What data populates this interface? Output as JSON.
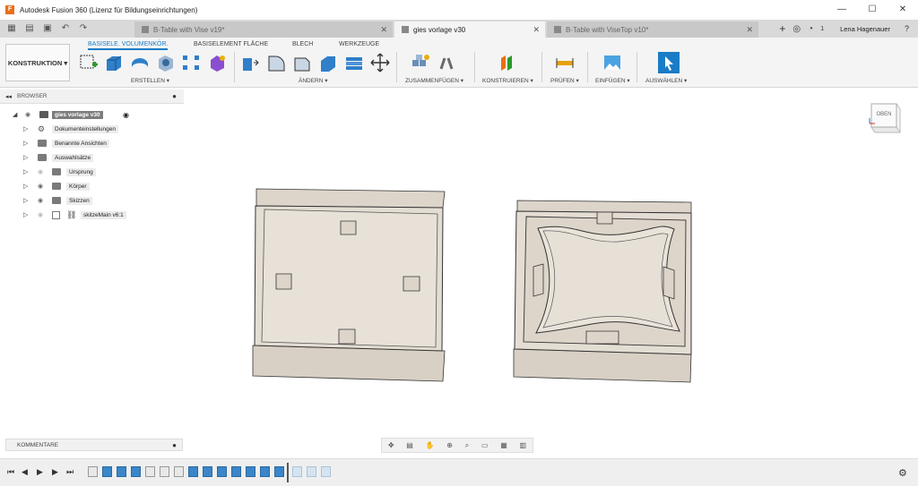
{
  "window": {
    "title": "Autodesk Fusion 360 (Lizenz für Bildungseinrichtungen)",
    "app_icon": "F",
    "minimize": "—",
    "maximize": "☐",
    "close": "✕"
  },
  "tabs": [
    {
      "label": "B-Table with Vise v19*",
      "active": false
    },
    {
      "label": "gies vorlage v30",
      "active": true
    },
    {
      "label": "B-Table with ViseTop v10*",
      "active": false
    }
  ],
  "tab_close": "✕",
  "header_right": {
    "job_count": "1",
    "user": "Lena Hagenauer"
  },
  "toolbar": {
    "workspace": "KONSTRUKTION ▾",
    "subtabs": [
      "BASISELE. VOLUMENKÖR.",
      "BASISELEMENT FLÄCHE",
      "BLECH",
      "WERKZEUGE"
    ],
    "groups": [
      "ERSTELLEN ▾",
      "ÄNDERN ▾",
      "ZUSAMMENFÜGEN ▾",
      "KONSTRUIEREN ▾",
      "PRÜFEN ▾",
      "EINFÜGEN ▾",
      "AUSWÄHLEN ▾"
    ]
  },
  "browser": {
    "title": "BROWSER",
    "root": "gies vorlage v30",
    "items": [
      {
        "label": "Dokumenteinstellungen",
        "icon": "gear-icon"
      },
      {
        "label": "Benannte Ansichten",
        "icon": "folder-icon"
      },
      {
        "label": "Auswahlsätze",
        "icon": "folder-icon"
      },
      {
        "label": "Ursprung",
        "icon": "folder-icon"
      },
      {
        "label": "Körper",
        "icon": "folder-icon"
      },
      {
        "label": "Skizzen",
        "icon": "folder-icon"
      },
      {
        "label": "skitzeMain v6:1",
        "icon": "link-icon"
      }
    ]
  },
  "comments": {
    "title": "KOMMENTARE"
  },
  "viewcube": {
    "face": "OBEN"
  },
  "colors": {
    "accent": "#1a7bc6",
    "model_fill": "#e0d9cf",
    "model_edge": "#3a3a3a",
    "timeline_feature": "#3a86c8"
  }
}
